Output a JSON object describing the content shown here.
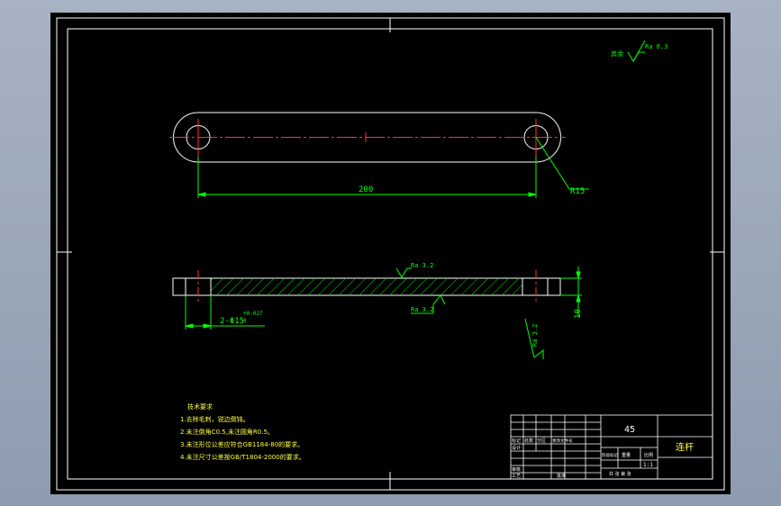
{
  "drawing": {
    "roughness_other": "其余",
    "roughness_other_value": "Ra 6.3",
    "dim_length": "200",
    "dim_radius": "R15",
    "roughness_top": "Ra 3.2",
    "roughness_bottom": "Ra 3.2",
    "roughness_hole": "Ra 3.2",
    "hole_callout": "2-Φ15",
    "tol_upper": "+0.027",
    "tol_lower": "0",
    "dim_thickness": "10"
  },
  "notes": {
    "title": "技术要求",
    "items": [
      "1.去除毛刺，锐边倒钝。",
      "2.未注倒角C0.5,未注圆角R0.5。",
      "3.未注形位公差应符合GB1184-80的要求。",
      "4.未注尺寸公差按GB/T1804-2000的要求。"
    ]
  },
  "title_block": {
    "material": "45",
    "part_name": "连杆",
    "scale": "1:1",
    "row_labels": [
      "标记",
      "处数",
      "分区",
      "更改文件号"
    ],
    "design": "设计",
    "review": "审核",
    "process": "工艺",
    "approve": "批准",
    "stage_mark": "阶段标记",
    "weight": "重量",
    "ratio": "比例",
    "sheets": "共 张  第 张"
  },
  "colors": {
    "line": "#ffffff",
    "center": "#ff3030",
    "dim": "#00ff00",
    "text": "#00ff00",
    "hatch": "#00e000",
    "notes": "#ffff40"
  }
}
